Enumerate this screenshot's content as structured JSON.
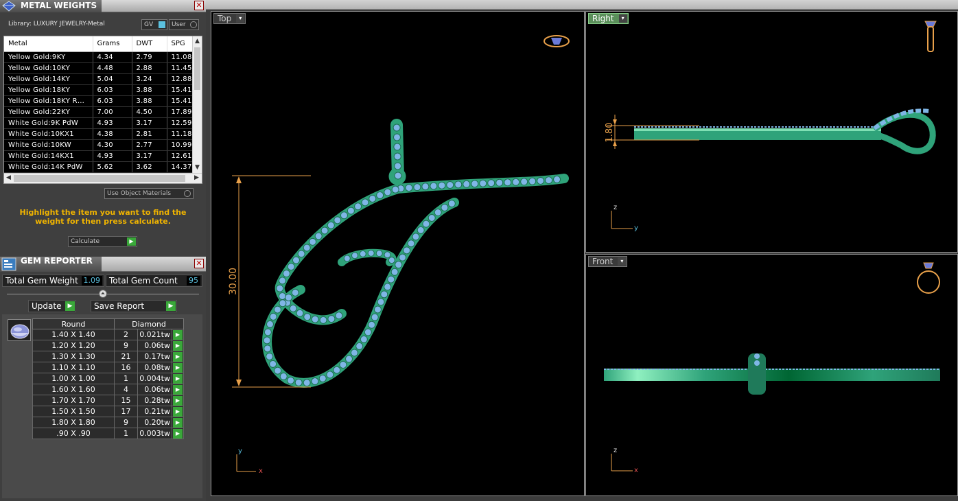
{
  "metal_weights": {
    "title": "METAL WEIGHTS",
    "library_label": "Library: LUXURY JEWELRY-Metal",
    "gv_label": "GV",
    "user_label": "User",
    "columns": [
      "Metal",
      "Grams",
      "DWT",
      "SPG"
    ],
    "rows": [
      [
        "Yellow Gold:9KY",
        "4.34",
        "2.79",
        "11.08"
      ],
      [
        "Yellow Gold:10KY",
        "4.48",
        "2.88",
        "11.45"
      ],
      [
        "Yellow Gold:14KY",
        "5.04",
        "3.24",
        "12.88"
      ],
      [
        "Yellow Gold:18KY",
        "6.03",
        "3.88",
        "15.41"
      ],
      [
        "Yellow Gold:18KY R…",
        "6.03",
        "3.88",
        "15.41"
      ],
      [
        "Yellow Gold:22KY",
        "7.00",
        "4.50",
        "17.89"
      ],
      [
        "White Gold:9K PdW",
        "4.93",
        "3.17",
        "12.59"
      ],
      [
        "White Gold:10KX1",
        "4.38",
        "2.81",
        "11.18"
      ],
      [
        "White Gold:10KW",
        "4.30",
        "2.77",
        "10.99"
      ],
      [
        "White Gold:14KX1",
        "4.93",
        "3.17",
        "12.61"
      ],
      [
        "White Gold:14K PdW",
        "5.62",
        "3.62",
        "14.37"
      ]
    ],
    "use_object_materials": "Use Object Materials",
    "hint": "Highlight the item you want to find the weight for then press calculate.",
    "calculate_label": "Calculate",
    "go_glyph": "▶",
    "close_glyph": "✕",
    "scroll_up": "▲",
    "scroll_down": "▼",
    "scroll_left": "◀",
    "scroll_right": "▶"
  },
  "gem_reporter": {
    "title": "GEM REPORTER",
    "total_weight_label": "Total Gem Weight",
    "total_weight_value": "1.09",
    "total_count_label": "Total Gem Count",
    "total_count_value": "95",
    "update_label": "Update",
    "save_report_label": "Save Report",
    "header_shape": "Round",
    "header_material": "Diamond",
    "rows": [
      [
        "1.40 X 1.40",
        "2",
        "0.021tw"
      ],
      [
        "1.20 X 1.20",
        "9",
        "0.06tw"
      ],
      [
        "1.30 X 1.30",
        "21",
        "0.17tw"
      ],
      [
        "1.10 X 1.10",
        "16",
        "0.08tw"
      ],
      [
        "1.00 X 1.00",
        "1",
        "0.004tw"
      ],
      [
        "1.60 X 1.60",
        "4",
        "0.06tw"
      ],
      [
        "1.70 X 1.70",
        "15",
        "0.28tw"
      ],
      [
        "1.50 X 1.50",
        "17",
        "0.21tw"
      ],
      [
        "1.80 X 1.80",
        "9",
        "0.20tw"
      ],
      [
        ".90 X .90",
        "1",
        "0.003tw"
      ]
    ]
  },
  "viewports": {
    "top": {
      "label": "Top",
      "dimension": "30.00",
      "axis_x": "x",
      "axis_y": "y"
    },
    "right": {
      "label": "Right",
      "dimension": "1.80",
      "axis_h": "y",
      "axis_v": "z"
    },
    "front": {
      "label": "Front",
      "axis_h": "x",
      "axis_v": "z"
    },
    "dropdown_glyph": "▾"
  },
  "colors": {
    "metal": "#2fa37a",
    "gem": "#7fb6e6",
    "dimension": "#e8a04a",
    "accent_green": "#3aa83a",
    "right_label_bg": "#5a8f5a"
  }
}
